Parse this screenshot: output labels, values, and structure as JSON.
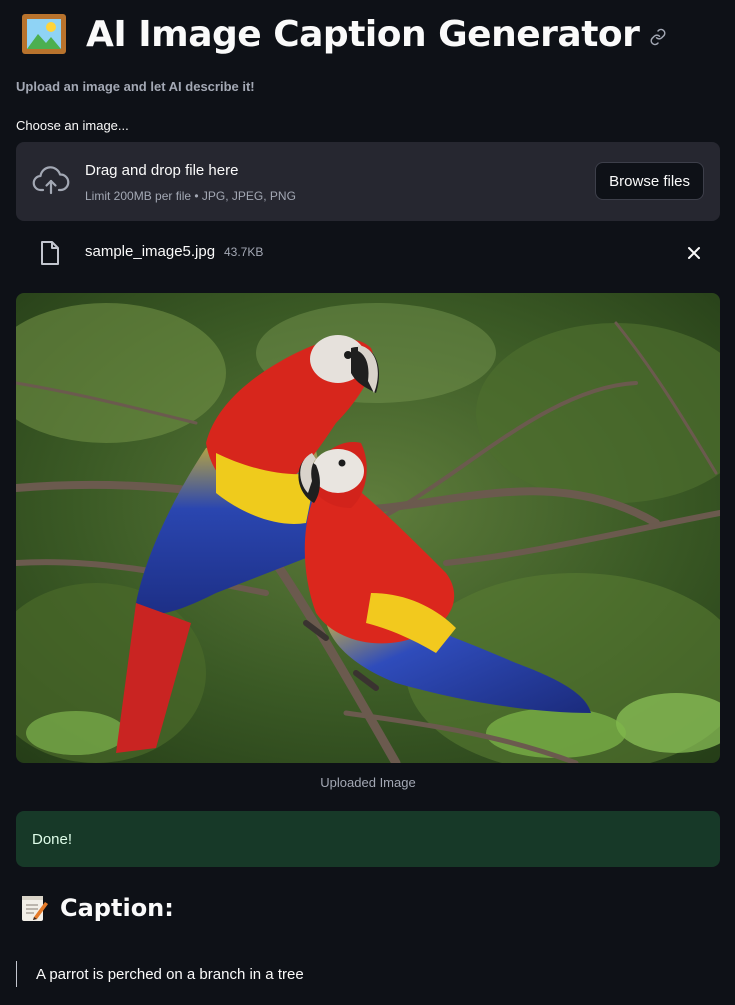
{
  "app": {
    "title": "AI Image Caption Generator",
    "subtitle": "Upload an image and let AI describe it!"
  },
  "uploader": {
    "label": "Choose an image...",
    "drop_title": "Drag and drop file here",
    "limit_text": "Limit 200MB per file • JPG, JPEG, PNG",
    "browse_label": "Browse files",
    "icon": "cloud-upload-icon"
  },
  "file": {
    "name": "sample_image5.jpg",
    "size": "43.7KB",
    "icon": "file-icon",
    "remove_icon": "close-icon"
  },
  "image": {
    "caption": "Uploaded Image"
  },
  "status": {
    "message": "Done!"
  },
  "result": {
    "heading": "Caption:",
    "text": "A parrot is perched on a branch in a tree"
  },
  "colors": {
    "background": "#0e1117",
    "surface": "#262730",
    "success_bg": "#173928",
    "success_text": "#dffde9",
    "muted_text": "#a3a8b4"
  }
}
